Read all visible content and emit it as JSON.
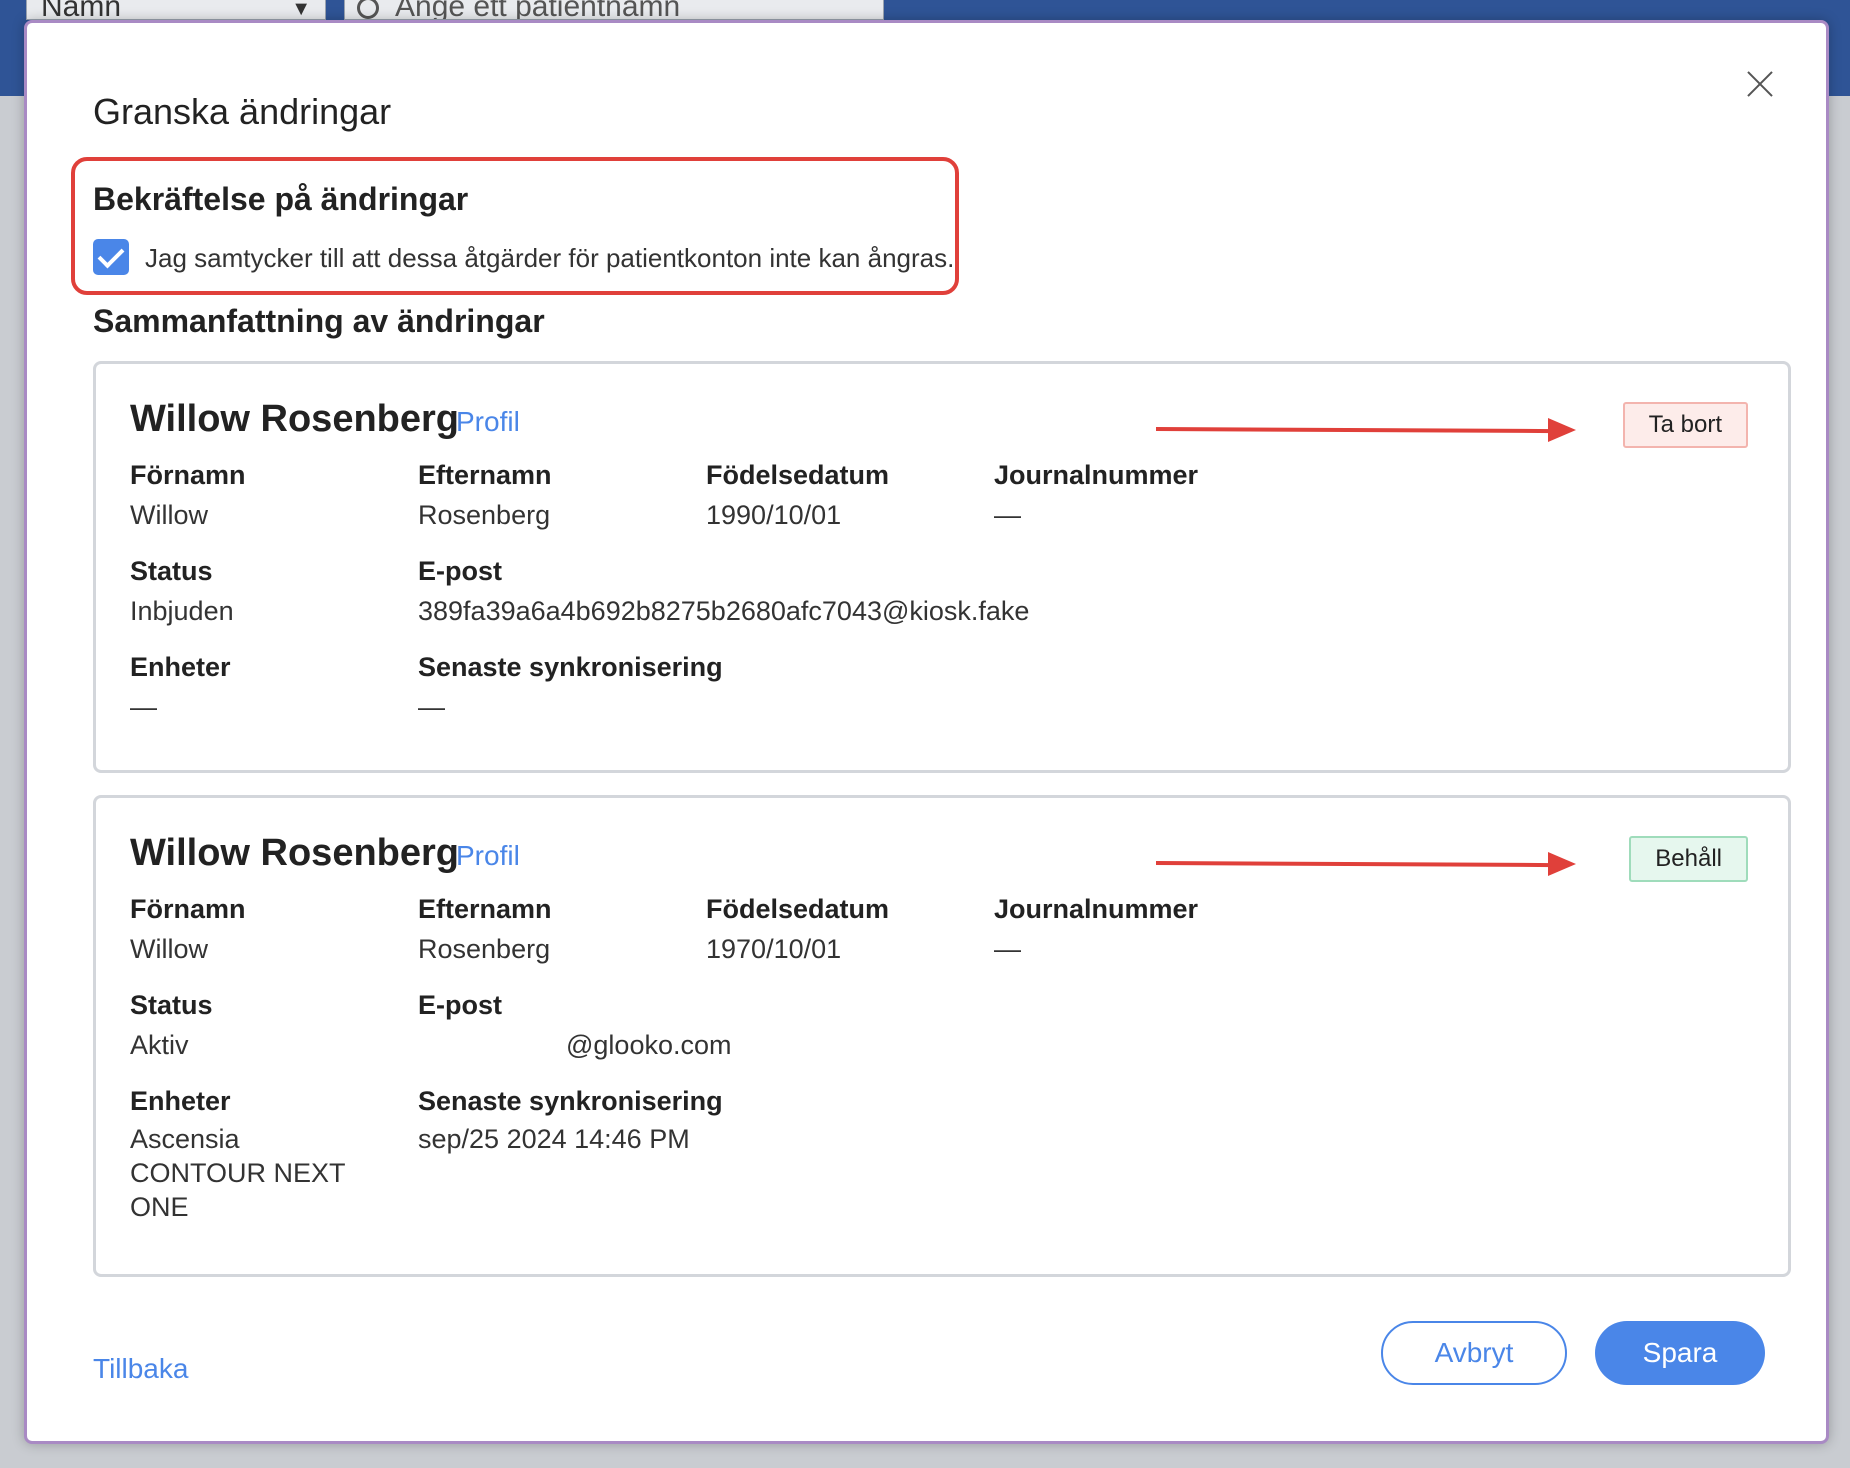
{
  "background": {
    "filter_select_value": "Namn",
    "search_placeholder": "Ange ett patientnamn"
  },
  "modal": {
    "title": "Granska ändringar",
    "consent": {
      "heading": "Bekräftelse på ändringar",
      "checked": true,
      "text": "Jag samtycker till att dessa åtgärder för patientkonton inte kan ångras."
    },
    "summary_heading": "Sammanfattning av ändringar",
    "cards": [
      {
        "name": "Willow Rosenberg",
        "profile_link": "Profil",
        "action": "Ta bort",
        "labels": {
          "first_name": "Förnamn",
          "last_name": "Efternamn",
          "dob": "Födelsedatum",
          "record": "Journalnummer",
          "status": "Status",
          "email": "E-post",
          "devices": "Enheter",
          "last_sync": "Senaste synkronisering"
        },
        "values": {
          "first_name": "Willow",
          "last_name": "Rosenberg",
          "dob": "1990/10/01",
          "record": "—",
          "status": "Inbjuden",
          "email": "389fa39a6a4b692b8275b2680afc7043@kiosk.fake",
          "devices": "—",
          "last_sync": "—"
        }
      },
      {
        "name": "Willow Rosenberg",
        "profile_link": "Profil",
        "action": "Behåll",
        "labels": {
          "first_name": "Förnamn",
          "last_name": "Efternamn",
          "dob": "Födelsedatum",
          "record": "Journalnummer",
          "status": "Status",
          "email": "E-post",
          "devices": "Enheter",
          "last_sync": "Senaste synkronisering"
        },
        "values": {
          "first_name": "Willow",
          "last_name": "Rosenberg",
          "dob": "1970/10/01",
          "record": "—",
          "status": "Aktiv",
          "email": "@glooko.com",
          "devices": "Ascensia CONTOUR NEXT ONE",
          "last_sync": "sep/25 2024 14:46 PM"
        }
      }
    ],
    "footer": {
      "back_label": "Tillbaka",
      "cancel_label": "Avbryt",
      "save_label": "Spara"
    }
  },
  "colors": {
    "accent": "#4a86e8",
    "annotation_red": "#e0403a",
    "remove_badge_bg": "#fdecea",
    "keep_badge_bg": "#e6f7ee"
  }
}
